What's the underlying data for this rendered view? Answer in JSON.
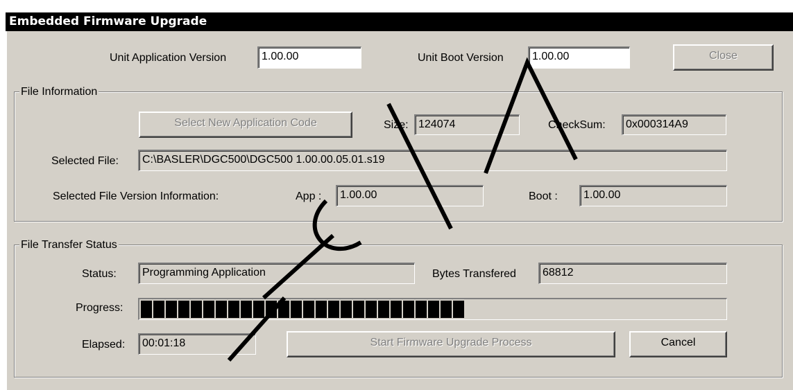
{
  "window": {
    "title": "Embedded Firmware Upgrade"
  },
  "versions": {
    "app_label": "Unit Application Version",
    "app_value": "1.00.00",
    "boot_label": "Unit Boot Version",
    "boot_value": "1.00.00"
  },
  "close_button": {
    "label": "Close"
  },
  "file_info": {
    "group_title": "File Information",
    "select_button": "Select New Application Code",
    "size_label": "Size:",
    "size_value": "124074",
    "checksum_label": "CheckSum:",
    "checksum_value": "0x000314A9",
    "selected_file_label": "Selected File:",
    "selected_file_value": "C:\\BASLER\\DGC500\\DGC500 1.00.00.05.01.s19",
    "version_info_label": "Selected File Version Information:",
    "app_label": "App :",
    "app_value": "1.00.00",
    "boot_label": "Boot :",
    "boot_value": "1.00.00"
  },
  "transfer": {
    "group_title": "File Transfer Status",
    "status_label": "Status:",
    "status_value": "Programming Application",
    "bytes_label": "Bytes Transfered",
    "bytes_value": "68812",
    "progress_label": "Progress:",
    "progress_fraction": 0.56,
    "progress_blocks": 26,
    "elapsed_label": "Elapsed:",
    "elapsed_value": "00:01:18",
    "start_button": "Start Firmware Upgrade Process",
    "cancel_button": "Cancel"
  },
  "colors": {
    "window_bg": "#d4d0c8",
    "titlebar_bg": "#000000",
    "progress_block": "#000000",
    "disabled_text": "#808080"
  }
}
